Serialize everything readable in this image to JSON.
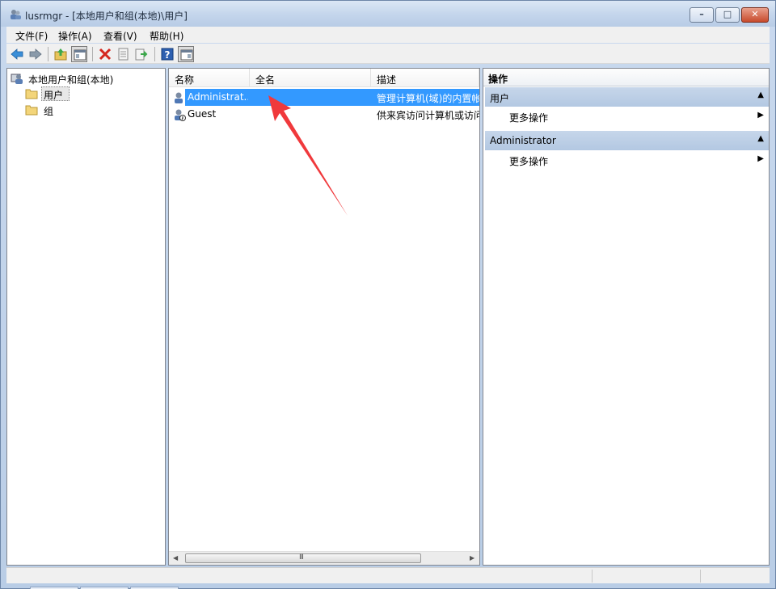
{
  "window": {
    "title": "lusrmgr - [本地用户和组(本地)\\用户]",
    "minimize_glyph": "–",
    "maximize_glyph": "□",
    "close_glyph": "✕"
  },
  "menu": [
    "文件(F)",
    "操作(A)",
    "查看(V)",
    "帮助(H)"
  ],
  "toolbar": {
    "icons": [
      "back-icon",
      "forward-icon",
      "up-folder-icon",
      "show-hide-tree-icon",
      "delete-icon",
      "properties-icon",
      "export-list-icon",
      "help-icon",
      "show-hide-action-pane-icon"
    ]
  },
  "tree": {
    "root": "本地用户和组(本地)",
    "items": [
      {
        "label": "用户",
        "selected": true
      },
      {
        "label": "组",
        "selected": false
      }
    ]
  },
  "list": {
    "columns": [
      "名称",
      "全名",
      "描述"
    ],
    "rows": [
      {
        "name": "Administrat...",
        "full_name": "",
        "description": "管理计算机(域)的内置帐",
        "selected": true
      },
      {
        "name": "Guest",
        "full_name": "",
        "description": "供来宾访问计算机或访问",
        "selected": false
      }
    ],
    "scroll_grip": "III"
  },
  "actions": {
    "title": "操作",
    "sections": [
      {
        "header": "用户",
        "items": [
          "更多操作"
        ]
      },
      {
        "header": "Administrator",
        "items": [
          "更多操作"
        ]
      }
    ],
    "collapse_glyph": "▲",
    "expand_glyph": "▶"
  },
  "colors": {
    "selection": "#3399ff",
    "section_header": "#b9cce3",
    "annotation_arrow": "#f0393c"
  }
}
